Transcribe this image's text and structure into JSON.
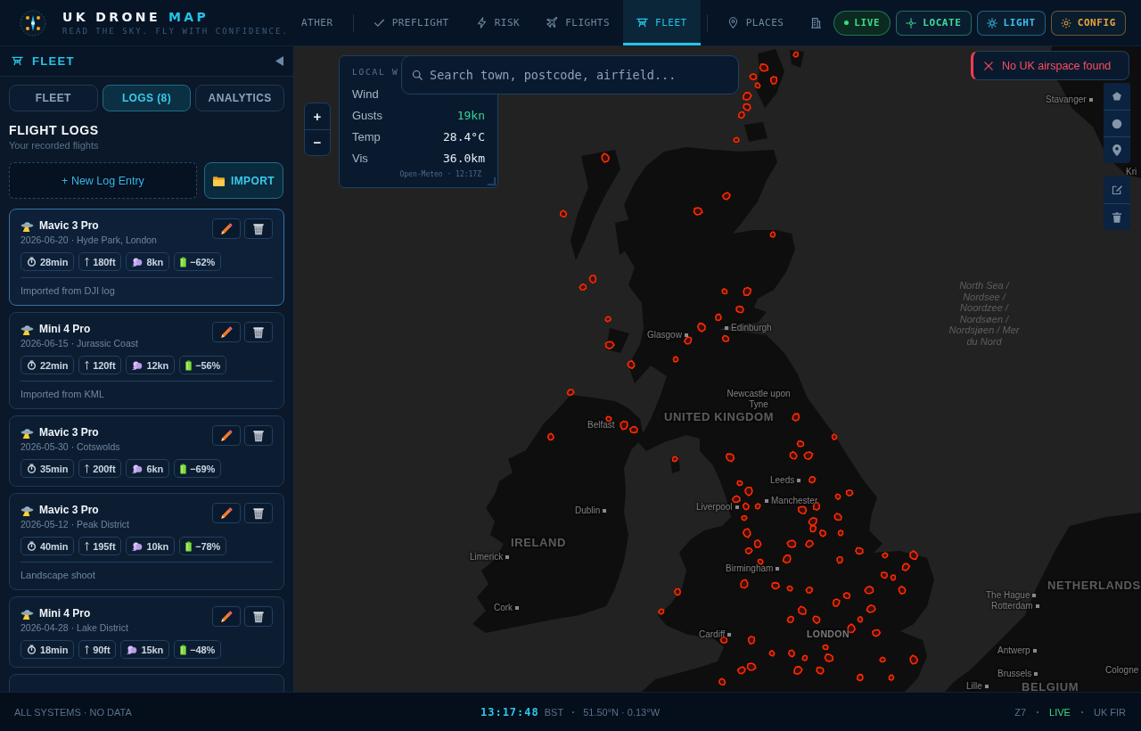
{
  "header": {
    "logo": {
      "title": "UK DRONE",
      "accent": "MAP",
      "tagline": "READ THE SKY. FLY WITH CONFIDENCE."
    },
    "nav": {
      "groups": [
        [
          {
            "label": "ATHER",
            "selected": false
          }
        ],
        [
          {
            "label": "PREFLIGHT",
            "selected": false
          },
          {
            "label": "RISK",
            "selected": false
          },
          {
            "label": "FLIGHTS",
            "selected": false
          },
          {
            "label": "FLEET",
            "selected": true
          }
        ],
        [
          {
            "label": "PLACES",
            "selected": false
          },
          {
            "selected": false
          }
        ]
      ]
    },
    "actions": [
      {
        "label": "LIVE",
        "kind": "status",
        "color": "#3ddc84"
      },
      {
        "label": "LOCATE",
        "kind": "button",
        "color": "#3fd99a"
      },
      {
        "label": "LIGHT",
        "kind": "button",
        "color": "#3cc0f0"
      },
      {
        "label": "CONFIG",
        "kind": "button",
        "color": "#e8a33a"
      }
    ]
  },
  "sidebar": {
    "title": "FLEET",
    "tabs": [
      {
        "label": "FLEET",
        "selected": false
      },
      {
        "label": "LOGS (8)",
        "selected": true
      },
      {
        "label": "ANALYTICS",
        "selected": false
      }
    ],
    "heading": "FLIGHT LOGS",
    "subheading": "Your recorded flights",
    "new_entry": "+ New Log Entry",
    "import": "IMPORT",
    "logs": [
      {
        "drone": "Mavic 3 Pro",
        "date_place": "2026-06-20 · Hyde Park, London",
        "duration": "28min",
        "altitude": "180ft",
        "wind": "8kn",
        "battery": "−62%",
        "note": "Imported from DJI log",
        "selected": true
      },
      {
        "drone": "Mini 4 Pro",
        "date_place": "2026-06-15 · Jurassic Coast",
        "duration": "22min",
        "altitude": "120ft",
        "wind": "12kn",
        "battery": "−56%",
        "note": "Imported from KML",
        "selected": false
      },
      {
        "drone": "Mavic 3 Pro",
        "date_place": "2026-05-30 · Cotswolds",
        "duration": "35min",
        "altitude": "200ft",
        "wind": "6kn",
        "battery": "−69%",
        "selected": false
      },
      {
        "drone": "Mavic 3 Pro",
        "date_place": "2026-05-12 · Peak District",
        "duration": "40min",
        "altitude": "195ft",
        "wind": "10kn",
        "battery": "−78%",
        "note": "Landscape shoot",
        "selected": false
      },
      {
        "drone": "Mini 4 Pro",
        "date_place": "2026-04-28 · Lake District",
        "duration": "18min",
        "altitude": "90ft",
        "wind": "15kn",
        "battery": "−48%",
        "selected": false
      },
      {
        "selected": false
      }
    ]
  },
  "map": {
    "zoom": [
      "+",
      "−"
    ],
    "weather": {
      "title": "LOCAL W",
      "rows": [
        {
          "label": "Wind"
        },
        {
          "label": "Gusts",
          "value": "19kn",
          "color": "#34d399"
        },
        {
          "label": "Temp",
          "value": "28.4°C",
          "color": "#e6edf3"
        },
        {
          "label": "Vis",
          "value": "36.0km",
          "color": "#e6edf3"
        }
      ],
      "source": "Open-Meteo · 12:17Z"
    },
    "search": {
      "placeholder": "Search town, postcode, airfield..."
    },
    "toast": {
      "message": "No UK airspace found"
    },
    "labels": [
      {
        "text": "North Sea / Nordsee / Noordzee / Nordsøen / Nordsjøen / Mer du Nord",
        "kind": "sea"
      },
      {
        "text": "Stavanger",
        "kind": "city"
      },
      {
        "text": "Kri",
        "kind": "city"
      },
      {
        "text": "Glasgow",
        "kind": "city"
      },
      {
        "text": "Edinburgh",
        "kind": "city"
      },
      {
        "text": "Newcastle upon Tyne",
        "kind": "city"
      },
      {
        "text": "UNITED KINGDOM",
        "kind": "country"
      },
      {
        "text": "Belfast",
        "kind": "city"
      },
      {
        "text": "Dublin",
        "kind": "city"
      },
      {
        "text": "IRELAND",
        "kind": "country"
      },
      {
        "text": "Limerick",
        "kind": "city"
      },
      {
        "text": "Cork",
        "kind": "city"
      },
      {
        "text": "Liverpool",
        "kind": "city"
      },
      {
        "text": "Manchester",
        "kind": "city"
      },
      {
        "text": "Leeds",
        "kind": "city"
      },
      {
        "text": "Birmingham",
        "kind": "city"
      },
      {
        "text": "Cardiff",
        "kind": "city"
      },
      {
        "text": "LONDON",
        "kind": "capital"
      },
      {
        "text": "NETHERLANDS",
        "kind": "country"
      },
      {
        "text": "The Hague",
        "kind": "city"
      },
      {
        "text": "Rotterdam",
        "kind": "city"
      },
      {
        "text": "Antwerp",
        "kind": "city"
      },
      {
        "text": "Brussels",
        "kind": "city"
      },
      {
        "text": "Lille",
        "kind": "city"
      },
      {
        "text": "BELGIUM",
        "kind": "country"
      },
      {
        "text": "Cologne",
        "kind": "city"
      }
    ]
  },
  "status_bar": {
    "left": "ALL SYSTEMS · NO DATA",
    "time": "13:17:48",
    "zone": "BST",
    "coords": "51.50°N · 0.13°W",
    "zoom": "Z7",
    "live": "LIVE",
    "region": "UK FIR"
  }
}
